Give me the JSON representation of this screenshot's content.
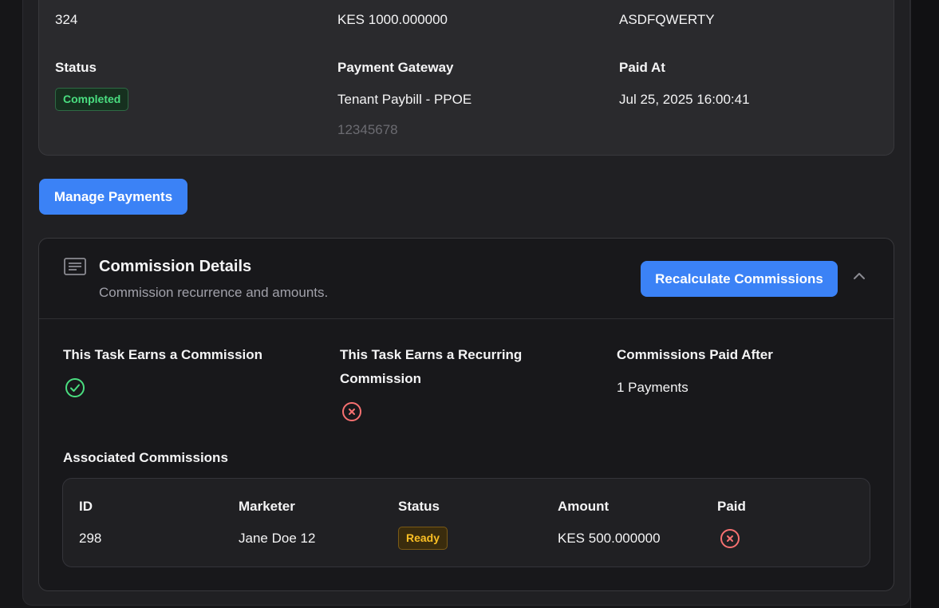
{
  "payment": {
    "row_values": {
      "id": "324",
      "amount": "KES 1000.000000",
      "reference": "ASDFQWERTY"
    },
    "status_label": "Status",
    "status_value": "Completed",
    "gateway_label": "Payment Gateway",
    "gateway_value": "Tenant Paybill - PPOE",
    "gateway_number": "12345678",
    "paid_at_label": "Paid At",
    "paid_at_value": "Jul 25, 2025 16:00:41"
  },
  "actions": {
    "manage_payments": "Manage Payments"
  },
  "commission": {
    "title": "Commission Details",
    "subtitle": "Commission recurrence and amounts.",
    "recalculate": "Recalculate Commissions",
    "earns_commission_label": "This Task Earns a Commission",
    "earns_commission": true,
    "recurring_label_line1": "This Task Earns a Recurring",
    "recurring_label_line2": "Commission",
    "recurring": false,
    "paid_after_label": "Commissions Paid After",
    "paid_after_value": "1 Payments",
    "associated_title": "Associated Commissions",
    "table": {
      "headers": [
        "ID",
        "Marketer",
        "Status",
        "Amount",
        "Paid"
      ],
      "rows": [
        {
          "id": "298",
          "marketer": "Jane Doe 12",
          "status": "Ready",
          "amount": "KES 500.000000",
          "paid": false
        }
      ]
    }
  },
  "colors": {
    "accent": "#3b82f6",
    "success": "#4ade80",
    "danger": "#f87171",
    "warning": "#fbbf24"
  },
  "icons": [
    "document-lines-icon",
    "chevron-up-icon",
    "check-circle-icon",
    "x-circle-icon"
  ]
}
